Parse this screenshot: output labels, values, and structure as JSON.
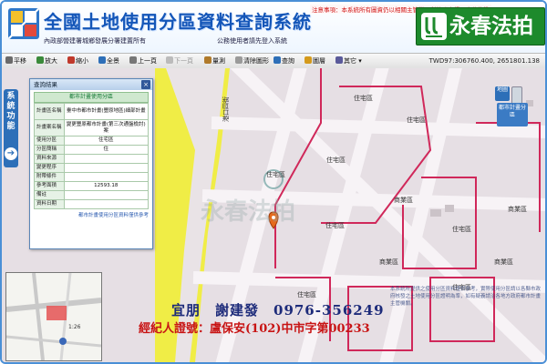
{
  "header": {
    "title": "全國土地使用分區資料查詢系統",
    "sub_left": "內政部營建署城鄉發展分署建置所有",
    "sub_right": "公務使用者請先登入系統",
    "notice": "注意事項：本系統所有圖資仍以相關主管機關所核發之證明文件為準",
    "brand": "永春法拍"
  },
  "toolbar": {
    "items": [
      "平移",
      "放大",
      "縮小",
      "全景",
      "上一頁",
      "下一頁",
      "量測",
      "清除圖形",
      "查詢",
      "圖層",
      "其它"
    ],
    "coords": "TWD97:306760.400, 2651801.138"
  },
  "side_tab": {
    "label": "系統功能"
  },
  "panel": {
    "title": "查詢結果",
    "section": "都市計畫使用分區",
    "rows": [
      {
        "k": "計畫區名稱",
        "v": "臺中市都市計畫(豐原地區)細部計畫"
      },
      {
        "k": "計畫案名稱",
        "v": "變更豐原都市計畫(第三次通盤檢討)案"
      },
      {
        "k": "使用分區",
        "v": "住宅區"
      },
      {
        "k": "分區簡稱",
        "v": "住"
      },
      {
        "k": "資料來源",
        "v": ""
      },
      {
        "k": "變更程序",
        "v": ""
      },
      {
        "k": "附帶條件",
        "v": ""
      },
      {
        "k": "參考面積",
        "v": "12593.18"
      },
      {
        "k": "備註",
        "v": ""
      },
      {
        "k": "資料日期",
        "v": ""
      }
    ],
    "footer": "都市計畫使用分區資料僅供參考"
  },
  "map_labels": {
    "zone_residential": "住宅區",
    "zone_commercial": "商業區",
    "road_label": "港口四街",
    "watermark": "永春法拍"
  },
  "right_tools": {
    "a": "地圖",
    "c": "都市計畫分區"
  },
  "minimap": {
    "scale": "1:26"
  },
  "footer": {
    "agent": "宜朋　謝建發　0976-356249",
    "license": "經紀人證號：盧保安(102)中市字第00233",
    "disclaimer": "本系統所提供之使用分區資料僅供參考，實際使用分區請以各縣市政府核發之土地使用分區證明為準，如有疑義請洽各地方政府都市計畫主管機關。"
  },
  "colors": {
    "brand_green": "#1d8a2c",
    "title_blue": "#1456b8",
    "commercial_red": "#d0285a",
    "residential_bg": "#e6dfe4",
    "road_yellow": "#f1ee34",
    "agent_blue": "#1d2b7a",
    "license_red": "#c81414"
  }
}
